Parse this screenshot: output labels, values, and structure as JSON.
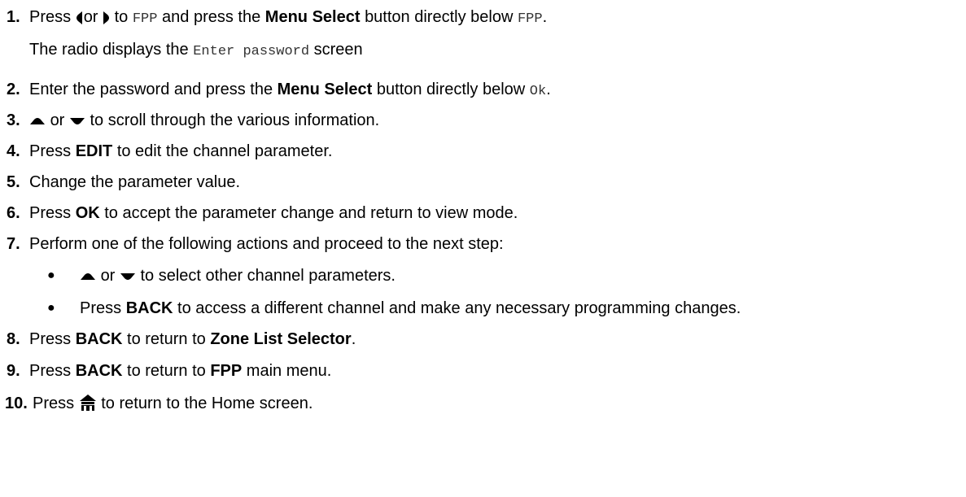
{
  "steps": [
    {
      "number": "1.",
      "parts": [
        "Press",
        "or",
        "to",
        "FPP",
        "and press the",
        "Menu Select",
        "button directly below",
        "FPP",
        "."
      ]
    },
    {
      "number": "",
      "parts": [
        "The radio displays the",
        "Enter password",
        "screen"
      ]
    },
    {
      "number": "2.",
      "parts": [
        "Enter the password and press the",
        "Menu Select",
        "button directly below",
        "Ok",
        "."
      ]
    },
    {
      "number": "3.",
      "parts": [
        "or",
        "to scroll through the various information."
      ]
    },
    {
      "number": "4.",
      "parts": [
        "Press",
        "EDIT",
        "to edit the channel parameter."
      ]
    },
    {
      "number": "5.",
      "parts": [
        "Change the parameter value."
      ]
    },
    {
      "number": "6.",
      "parts": [
        "Press",
        "OK",
        "to accept the parameter change and return to view mode."
      ]
    },
    {
      "number": "7.",
      "parts": [
        "Perform one of the following actions and proceed to the next step:"
      ]
    },
    {
      "bullet": "●",
      "parts": [
        "or",
        "to select other channel parameters."
      ]
    },
    {
      "bullet": "●",
      "parts": [
        "Press",
        "BACK",
        "to access a different channel and make any necessary programming changes."
      ]
    },
    {
      "number": "8.",
      "parts": [
        "Press",
        "BACK",
        "to return to",
        "Zone List Selector",
        "."
      ]
    },
    {
      "number": "9.",
      "parts": [
        "Press",
        "BACK",
        "to return to",
        "FPP",
        "main menu."
      ]
    },
    {
      "number": "10.",
      "parts": [
        "Press",
        "to return to the Home screen."
      ]
    }
  ],
  "icons": {
    "left": "left-arrow-icon",
    "right": "right-arrow-icon",
    "up": "up-arrow-icon",
    "down": "down-arrow-icon",
    "home": "home-icon"
  },
  "colors": {
    "text": "#000000",
    "mono_text": "#333333"
  }
}
